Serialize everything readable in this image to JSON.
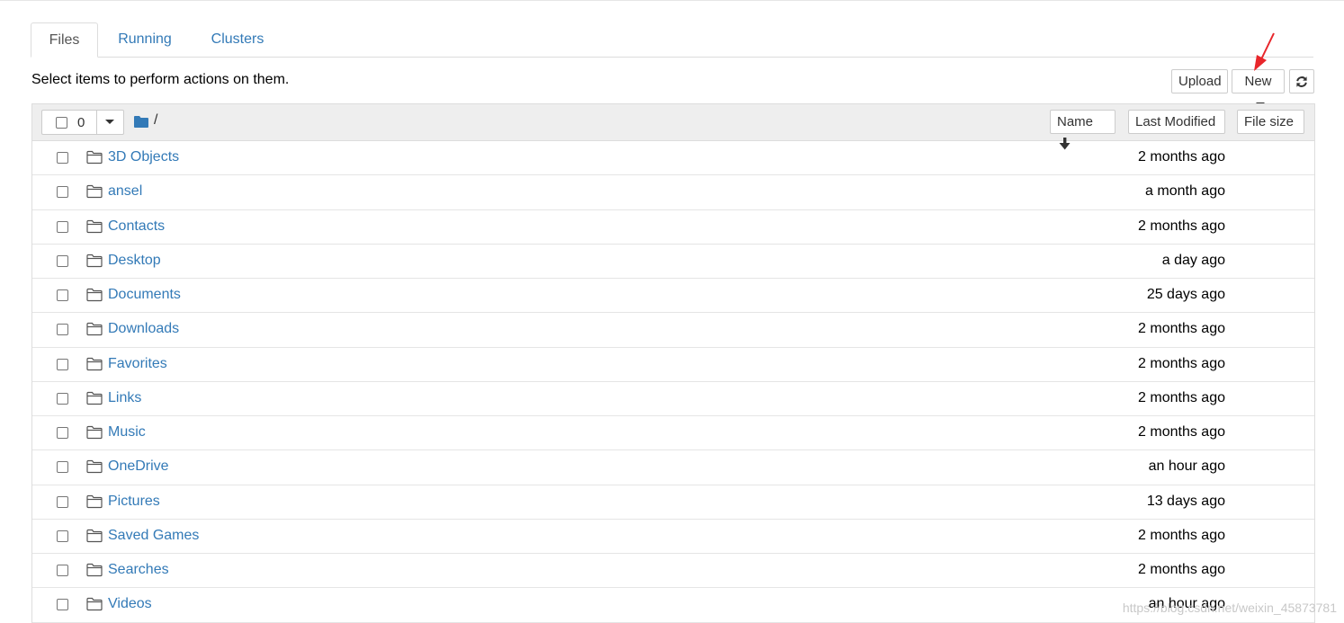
{
  "tabs": [
    {
      "label": "Files",
      "active": true
    },
    {
      "label": "Running",
      "active": false
    },
    {
      "label": "Clusters",
      "active": false
    }
  ],
  "toolbar": {
    "hint": "Select items to perform actions on them.",
    "upload_label": "Upload",
    "new_label": "New",
    "refresh_icon": "refresh-icon"
  },
  "list_header": {
    "selected_count": "0",
    "breadcrumb_path": "/",
    "sort_name_label": "Name",
    "sort_name_icon": "arrow-down-icon",
    "last_modified_label": "Last Modified",
    "file_size_label": "File size"
  },
  "files": [
    {
      "name": "3D Objects",
      "modified": "2 months ago"
    },
    {
      "name": "ansel",
      "modified": "a month ago"
    },
    {
      "name": "Contacts",
      "modified": "2 months ago"
    },
    {
      "name": "Desktop",
      "modified": "a day ago"
    },
    {
      "name": "Documents",
      "modified": "25 days ago"
    },
    {
      "name": "Downloads",
      "modified": "2 months ago"
    },
    {
      "name": "Favorites",
      "modified": "2 months ago"
    },
    {
      "name": "Links",
      "modified": "2 months ago"
    },
    {
      "name": "Music",
      "modified": "2 months ago"
    },
    {
      "name": "OneDrive",
      "modified": "an hour ago"
    },
    {
      "name": "Pictures",
      "modified": "13 days ago"
    },
    {
      "name": "Saved Games",
      "modified": "2 months ago"
    },
    {
      "name": "Searches",
      "modified": "2 months ago"
    },
    {
      "name": "Videos",
      "modified": "an hour ago"
    }
  ],
  "watermark": "https://blog.csdn.net/weixin_45873781",
  "colors": {
    "link": "#337ab7",
    "header_bg": "#eeeeee",
    "annotation_arrow": "#e8262b"
  }
}
